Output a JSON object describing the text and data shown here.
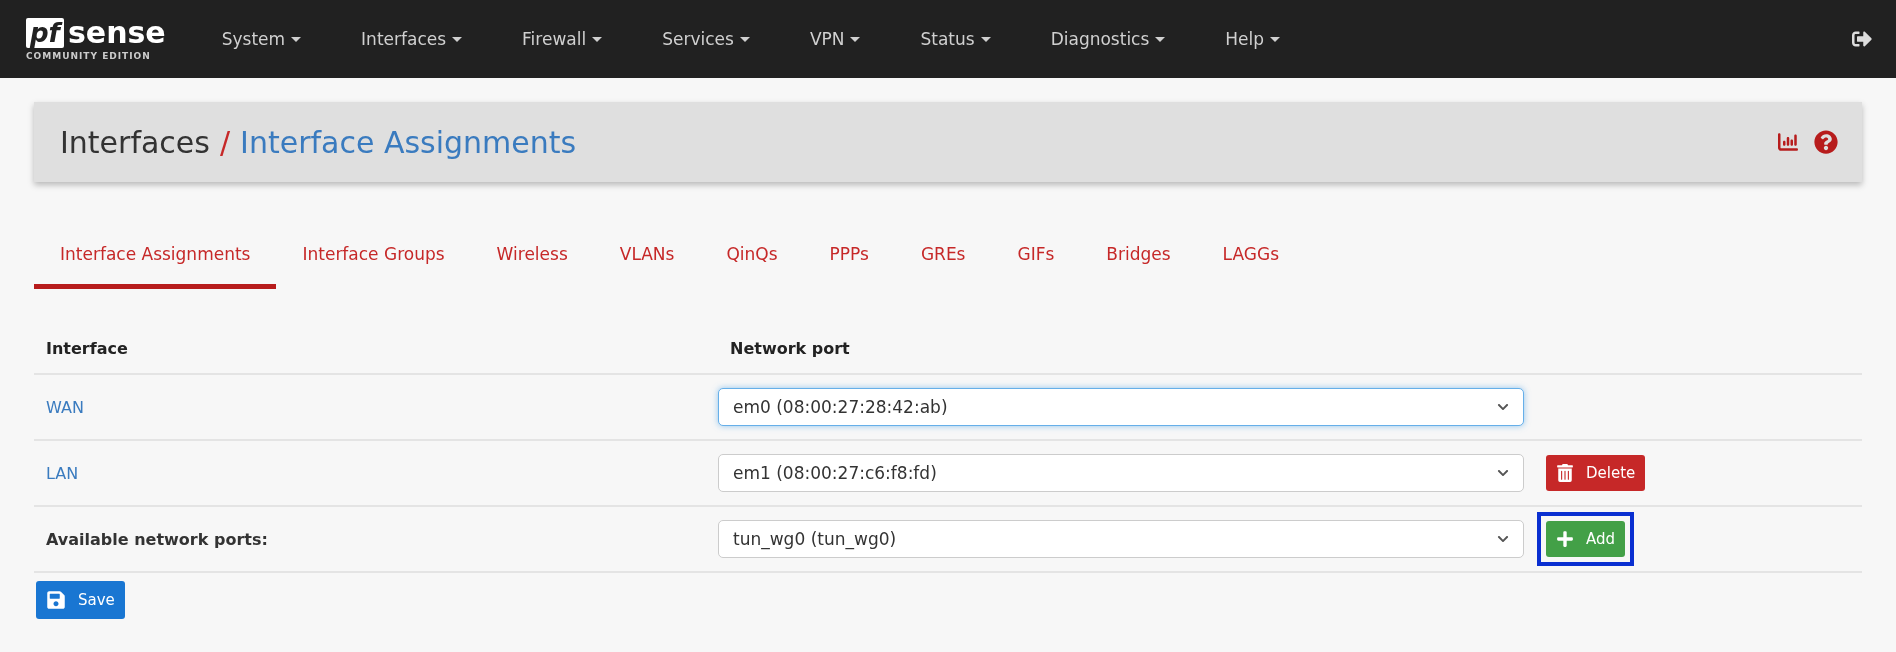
{
  "logo": {
    "mark": "pf",
    "name": "sense",
    "edition": "COMMUNITY EDITION"
  },
  "nav": [
    {
      "label": "System"
    },
    {
      "label": "Interfaces"
    },
    {
      "label": "Firewall"
    },
    {
      "label": "Services"
    },
    {
      "label": "VPN"
    },
    {
      "label": "Status"
    },
    {
      "label": "Diagnostics"
    },
    {
      "label": "Help"
    }
  ],
  "breadcrumb": {
    "parent": "Interfaces",
    "separator": "/",
    "current": "Interface Assignments"
  },
  "tabs": [
    {
      "label": "Interface Assignments",
      "selected": true
    },
    {
      "label": "Interface Groups",
      "selected": false
    },
    {
      "label": "Wireless",
      "selected": false
    },
    {
      "label": "VLANs",
      "selected": false
    },
    {
      "label": "QinQs",
      "selected": false
    },
    {
      "label": "PPPs",
      "selected": false
    },
    {
      "label": "GREs",
      "selected": false
    },
    {
      "label": "GIFs",
      "selected": false
    },
    {
      "label": "Bridges",
      "selected": false
    },
    {
      "label": "LAGGs",
      "selected": false
    }
  ],
  "table": {
    "columns": [
      "Interface",
      "Network port"
    ],
    "rows": [
      {
        "kind": "assigned",
        "interface": "WAN",
        "port": "em0 (08:00:27:28:42:ab)",
        "focused": true
      },
      {
        "kind": "assigned",
        "interface": "LAN",
        "port": "em1 (08:00:27:c6:f8:fd)",
        "focused": false,
        "action": "Delete"
      },
      {
        "kind": "available",
        "interface": "Available network ports:",
        "port": "tun_wg0 (tun_wg0)",
        "focused": false,
        "action": "Add",
        "highlighted": true
      }
    ]
  },
  "save_button": "Save"
}
